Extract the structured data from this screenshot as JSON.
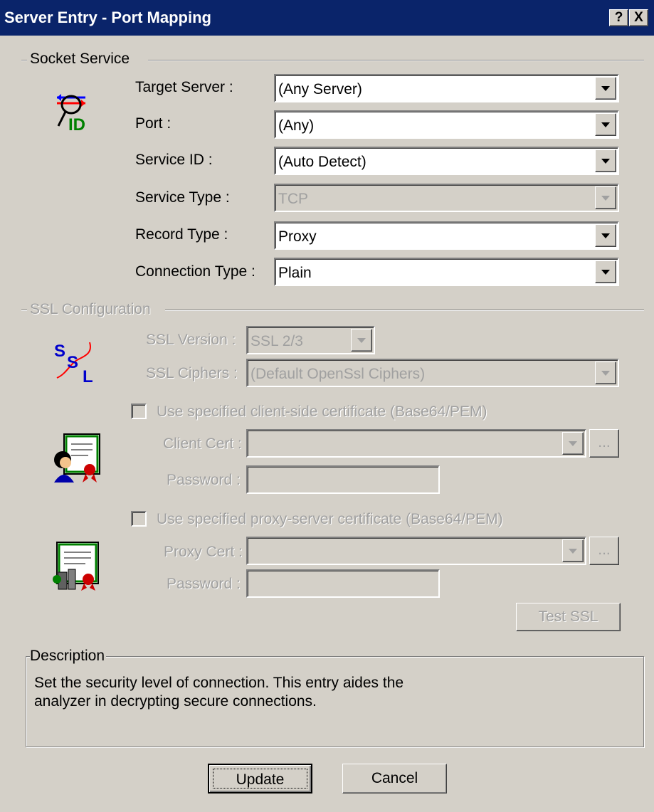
{
  "window": {
    "title": "Server Entry - Port Mapping",
    "help_label": "?",
    "close_label": "X"
  },
  "socket": {
    "legend": "Socket Service",
    "target_server_label": "Target Server :",
    "target_server_value": "(Any Server)",
    "port_label": "Port :",
    "port_value": "(Any)",
    "service_id_label": "Service ID :",
    "service_id_value": "(Auto Detect)",
    "service_type_label": "Service Type :",
    "service_type_value": "TCP",
    "record_type_label": "Record Type :",
    "record_type_value": "Proxy",
    "connection_type_label": "Connection Type :",
    "connection_type_value": "Plain",
    "icon": "socket-id-icon",
    "icon_text": "ID"
  },
  "ssl": {
    "legend": "SSL Configuration",
    "version_label": "SSL Version :",
    "version_value": "SSL 2/3",
    "ciphers_label": "SSL Ciphers :",
    "ciphers_value": "(Default OpenSsl Ciphers)",
    "client_check_label": "Use specified client-side certificate (Base64/PEM)",
    "client_cert_label": "Client Cert :",
    "client_password_label": "Password :",
    "proxy_check_label": "Use specified proxy-server certificate (Base64/PEM)",
    "proxy_cert_label": "Proxy Cert :",
    "proxy_password_label": "Password :",
    "browse_label": "...",
    "test_button": "Test SSL",
    "icon": "ssl-icon",
    "icon_letters": [
      "S",
      "S",
      "L"
    ]
  },
  "description": {
    "legend": "Description",
    "line1": "Set the security level of connection.  This entry aides the",
    "line2": "analyzer in decrypting secure connections."
  },
  "buttons": {
    "update": "Update",
    "cancel": "Cancel"
  },
  "colors": {
    "titlebar": "#0a246a",
    "face": "#d4d0c8",
    "disabled_text": "#a0a0a0"
  }
}
